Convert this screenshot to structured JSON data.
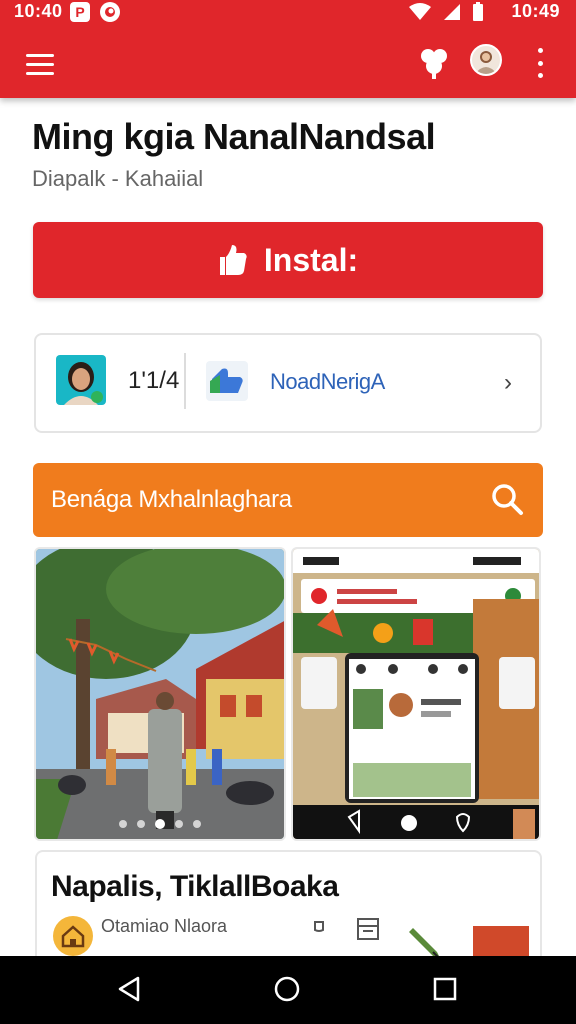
{
  "status_bar": {
    "time_left": "10:40",
    "time_right": "10:49",
    "notification_label": "P"
  },
  "app": {
    "title": "Ming kgia NanalNandsal",
    "subtitle": "Diapalk - Kahaiial",
    "install_label": "Instal:"
  },
  "stats": {
    "count": "1'1/4",
    "developer": "NoadNerigA"
  },
  "search": {
    "label": "Benága Mxhalnlaghara"
  },
  "post": {
    "title": "Napalis, TiklallBoaka",
    "subtitle": "Otamiao Nlaora"
  },
  "colors": {
    "primary": "#e0262b",
    "search": "#f07c1d",
    "link": "#2e63b8"
  },
  "icons": [
    "menu-icon",
    "share-icon",
    "avatar",
    "more-icon",
    "install-icon",
    "like-icon",
    "search-icon",
    "home-icon",
    "back-icon",
    "recent-icon"
  ]
}
